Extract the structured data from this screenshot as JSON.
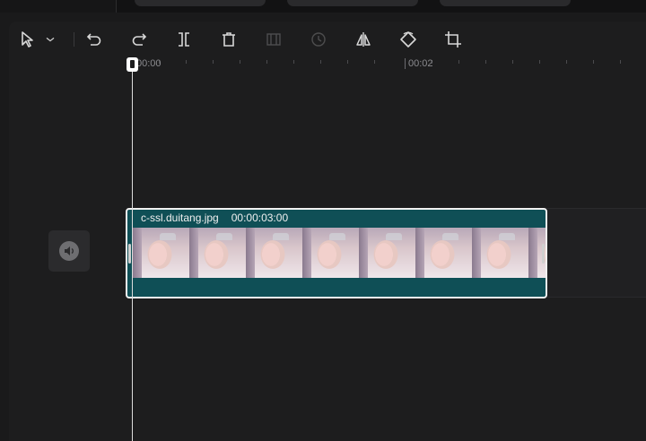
{
  "toolbar": {
    "tools": [
      {
        "name": "select-tool",
        "icon": "cursor-arrow-icon",
        "disabled": false
      },
      {
        "name": "select-dropdown",
        "icon": "chevron-down-icon",
        "disabled": false
      },
      {
        "name": "undo-button",
        "icon": "undo-icon",
        "disabled": false
      },
      {
        "name": "redo-button",
        "icon": "redo-icon",
        "disabled": false
      },
      {
        "name": "split-button",
        "icon": "split-icon",
        "disabled": false
      },
      {
        "name": "delete-button",
        "icon": "trash-icon",
        "disabled": false
      },
      {
        "name": "freeze-frame-button",
        "icon": "freeze-frame-icon",
        "disabled": true
      },
      {
        "name": "reverse-button",
        "icon": "reverse-icon",
        "disabled": true
      },
      {
        "name": "mirror-button",
        "icon": "mirror-icon",
        "disabled": false
      },
      {
        "name": "rotate-button",
        "icon": "rotate-icon",
        "disabled": false
      },
      {
        "name": "crop-button",
        "icon": "crop-icon",
        "disabled": false
      }
    ]
  },
  "ruler": {
    "labels": [
      "00:00",
      "00:02"
    ]
  },
  "track": {
    "mute_icon": "speaker-icon"
  },
  "clip": {
    "name": "c-ssl.duitang.jpg",
    "duration": "00:00:03:00",
    "color": "#0f4f56",
    "thumbnail_count": 7
  },
  "colors": {
    "background": "#1a1a1b",
    "panel": "#1d1d1e",
    "clip_teal": "#0f4f56",
    "playhead": "#ffffff"
  }
}
